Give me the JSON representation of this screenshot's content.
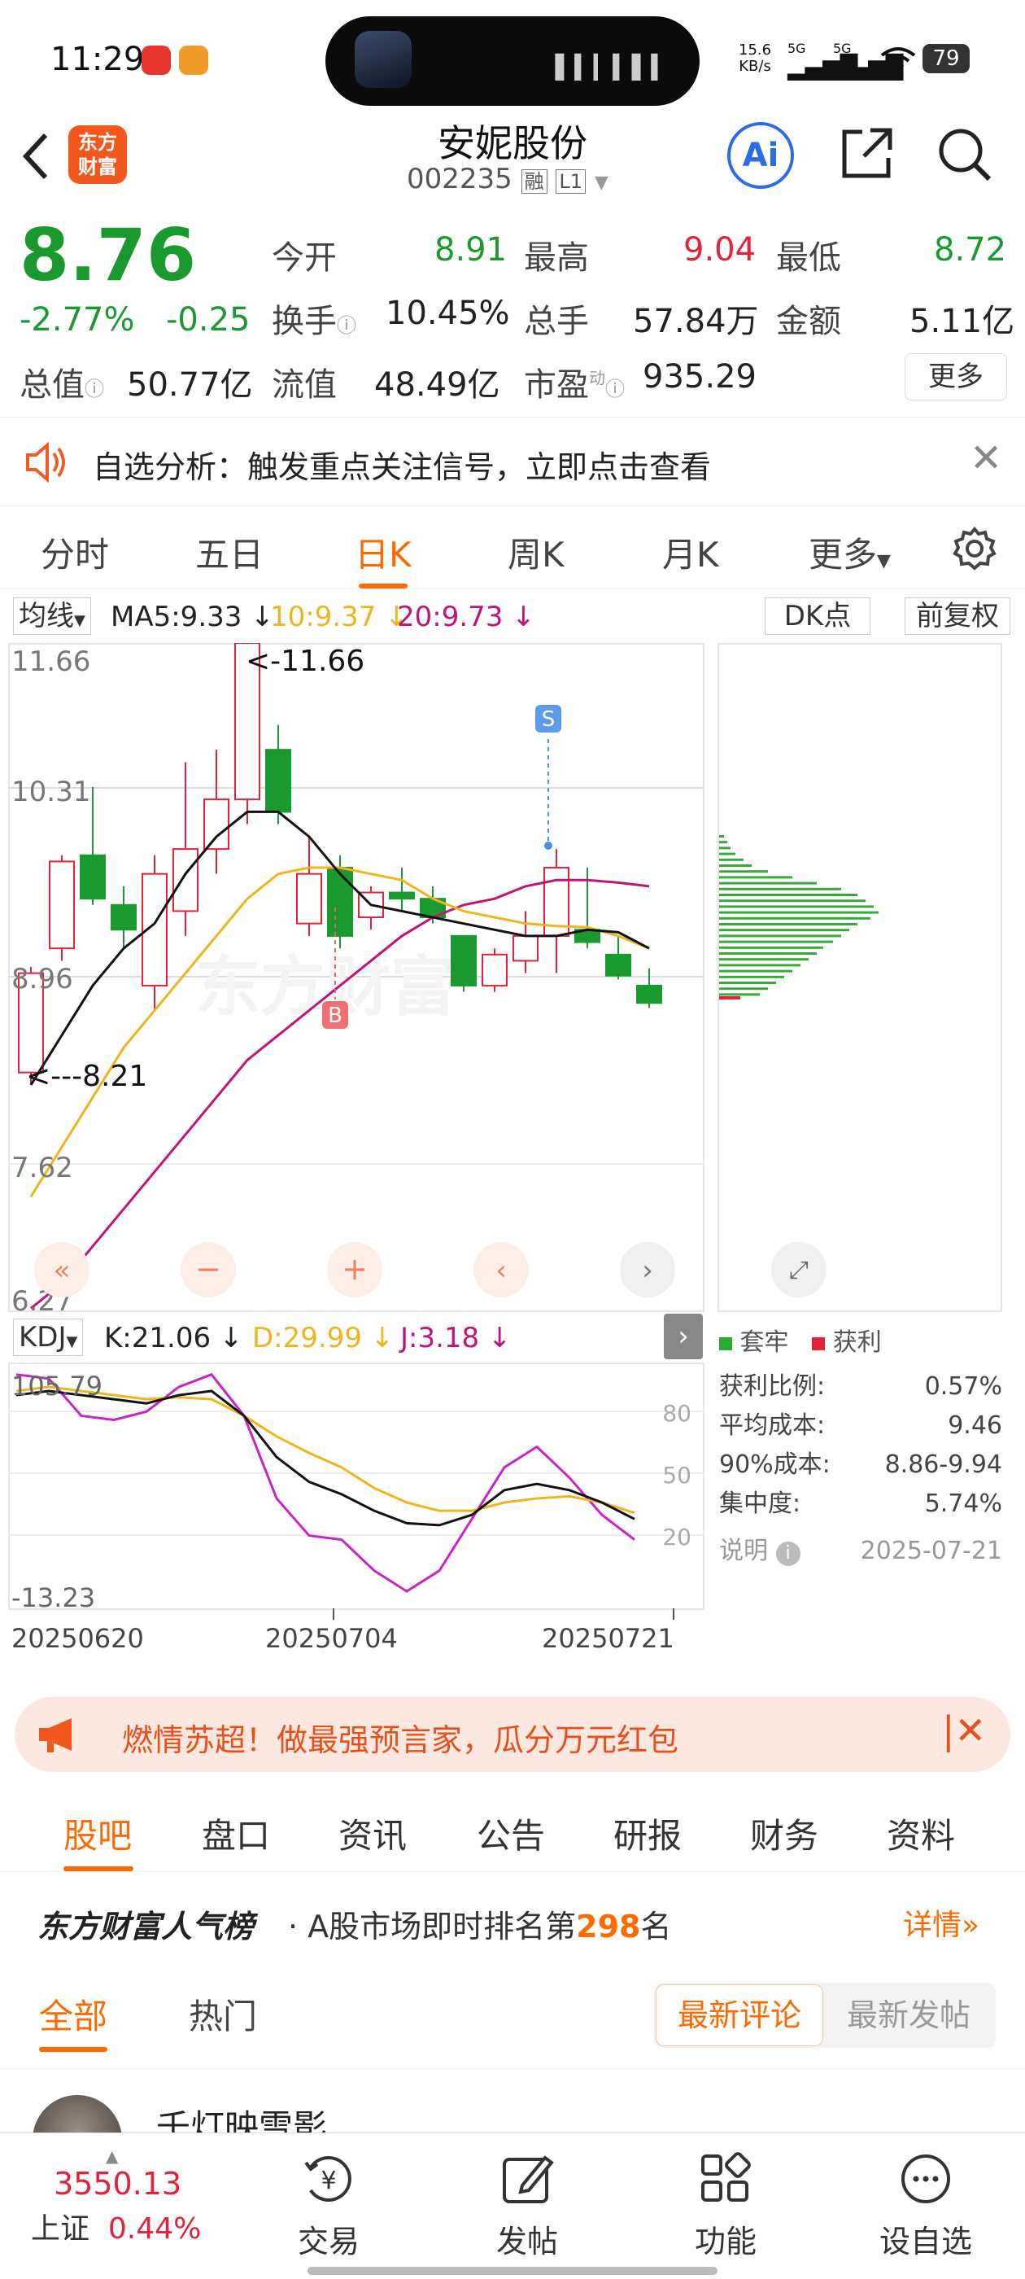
{
  "status": {
    "time": "11:29",
    "net_speed": "15.6",
    "net_unit": "KB/s",
    "sig1": "5G",
    "sig2": "5G",
    "battery": "79"
  },
  "nav": {
    "title": "安妮股份",
    "code": "002235",
    "tag1": "融",
    "tag2": "L1",
    "logo_line1": "东方",
    "logo_line2": "财富",
    "ai": "Ai"
  },
  "quote": {
    "price": "8.76",
    "pct": "-2.77%",
    "chg": "-0.25",
    "open_label": "今开",
    "open": "8.91",
    "high_label": "最高",
    "high": "9.04",
    "low_label": "最低",
    "low": "8.72",
    "turnover_label": "换手",
    "turnover": "10.45%",
    "volume_label": "总手",
    "volume": "57.84万",
    "amount_label": "金额",
    "amount": "5.11亿",
    "mktcap_label": "总值",
    "mktcap": "50.77亿",
    "float_label": "流值",
    "float": "48.49亿",
    "pe_label": "市盈",
    "pe_sup": "动",
    "pe": "935.29",
    "more": "更多"
  },
  "notice": {
    "text": "自选分析：触发重点关注信号，立即点击查看"
  },
  "chart_tabs": [
    "分时",
    "五日",
    "日K",
    "周K",
    "月K",
    "更多"
  ],
  "ma_bar": {
    "sel": "均线",
    "ma5": "MA5:9.33 ↓",
    "ma10": "10:9.37 ↓",
    "ma20": "20:9.73 ↓",
    "dk": "DK点",
    "adj": "前复权"
  },
  "kline_labels": {
    "y1": "11.66",
    "y2": "10.31",
    "y3": "8.96",
    "y4": "7.62",
    "y5": "6.27",
    "hi": "<-11.66",
    "lo": "<---8.21",
    "s": "S",
    "b": "B",
    "watermark": "东方财富"
  },
  "kdj_bar": {
    "sel": "KDJ",
    "k": "K:21.06 ↓",
    "d": "D:29.99 ↓",
    "j": "J:3.18 ↓"
  },
  "kdj_labels": {
    "top": "105.79",
    "bot": "-13.23",
    "l80": "80",
    "l50": "50",
    "l20": "20"
  },
  "dates": {
    "d1": "20250620",
    "d2": "20250704",
    "d3": "20250721"
  },
  "chip": {
    "legend_trap": "套牢",
    "legend_profit": "获利",
    "rows": [
      {
        "k": "获利比例:",
        "v": "0.57%"
      },
      {
        "k": "平均成本:",
        "v": "9.46"
      },
      {
        "k": "90%成本:",
        "v": "8.86-9.94"
      },
      {
        "k": "集中度:",
        "v": "5.74%"
      }
    ],
    "note": "说明",
    "date": "2025-07-21"
  },
  "banner": {
    "text": "燃情苏超！做最强预言家，瓜分万元红包"
  },
  "sub_tabs": [
    "股吧",
    "盘口",
    "资讯",
    "公告",
    "研报",
    "财务",
    "资料"
  ],
  "rank": {
    "brand": "东方财富人气榜",
    "text_a": "· A股市场即时排名第",
    "num": "298",
    "text_b": "名",
    "detail": "详情"
  },
  "filter": {
    "all": "全部",
    "hot": "热门",
    "latest_comment": "最新评论",
    "latest_post": "最新发帖"
  },
  "post": {
    "author": "千灯映雪影"
  },
  "bottom": {
    "index_val": "3550.13",
    "index_name": "上证",
    "index_pct": "0.44%",
    "tabs": [
      "交易",
      "发帖",
      "功能",
      "设自选"
    ]
  },
  "chart_data": {
    "type": "candlestick",
    "dates_visible": [
      "20250620",
      "20250704",
      "20250721"
    ],
    "ylim": [
      6.27,
      11.66
    ],
    "candles": [
      {
        "o": 8.2,
        "c": 9.0,
        "h": 9.05,
        "l": 8.1
      },
      {
        "o": 9.2,
        "c": 9.9,
        "h": 9.95,
        "l": 9.1
      },
      {
        "o": 9.95,
        "c": 9.6,
        "h": 10.5,
        "l": 9.55
      },
      {
        "o": 9.55,
        "c": 9.35,
        "h": 9.7,
        "l": 9.2
      },
      {
        "o": 8.9,
        "c": 9.8,
        "h": 9.95,
        "l": 8.7
      },
      {
        "o": 9.5,
        "c": 10.0,
        "h": 10.7,
        "l": 9.3
      },
      {
        "o": 10.0,
        "c": 10.4,
        "h": 10.8,
        "l": 9.8
      },
      {
        "o": 10.4,
        "c": 11.66,
        "h": 11.66,
        "l": 10.2
      },
      {
        "o": 10.8,
        "c": 10.3,
        "h": 11.0,
        "l": 10.2
      },
      {
        "o": 9.4,
        "c": 9.8,
        "h": 10.1,
        "l": 9.3
      },
      {
        "o": 9.85,
        "c": 9.3,
        "h": 9.95,
        "l": 9.2
      },
      {
        "o": 9.45,
        "c": 9.65,
        "h": 9.7,
        "l": 9.35
      },
      {
        "o": 9.65,
        "c": 9.6,
        "h": 9.85,
        "l": 9.5
      },
      {
        "o": 9.6,
        "c": 9.45,
        "h": 9.7,
        "l": 9.4
      },
      {
        "o": 9.3,
        "c": 8.9,
        "h": 9.3,
        "l": 8.85
      },
      {
        "o": 8.9,
        "c": 9.15,
        "h": 9.2,
        "l": 8.85
      },
      {
        "o": 9.1,
        "c": 9.3,
        "h": 9.5,
        "l": 9.0
      },
      {
        "o": 9.3,
        "c": 9.85,
        "h": 10.0,
        "l": 9.0
      },
      {
        "o": 9.35,
        "c": 9.25,
        "h": 9.85,
        "l": 9.2
      },
      {
        "o": 9.15,
        "c": 8.98,
        "h": 9.3,
        "l": 8.95
      },
      {
        "o": 8.9,
        "c": 8.76,
        "h": 9.04,
        "l": 8.72
      }
    ],
    "ma5": [
      8.1,
      8.5,
      8.9,
      9.2,
      9.4,
      9.8,
      10.1,
      10.3,
      10.3,
      10.1,
      9.8,
      9.55,
      9.5,
      9.45,
      9.4,
      9.35,
      9.3,
      9.3,
      9.35,
      9.33,
      9.2
    ],
    "ma10": [
      7.2,
      7.6,
      8.0,
      8.4,
      8.7,
      9.0,
      9.3,
      9.6,
      9.8,
      9.85,
      9.85,
      9.8,
      9.75,
      9.6,
      9.5,
      9.45,
      9.4,
      9.38,
      9.37,
      9.3,
      9.2
    ],
    "ma20": [
      6.3,
      6.5,
      6.8,
      7.1,
      7.4,
      7.7,
      8.0,
      8.3,
      8.5,
      8.7,
      8.9,
      9.1,
      9.3,
      9.45,
      9.55,
      9.6,
      9.7,
      9.75,
      9.75,
      9.73,
      9.7
    ],
    "kdj_ylim": [
      -13.23,
      105.79
    ],
    "K": [
      90,
      92,
      90,
      88,
      86,
      90,
      92,
      80,
      60,
      48,
      42,
      34,
      28,
      27,
      32,
      44,
      47,
      44,
      38,
      30
    ],
    "D": [
      92,
      94,
      92,
      90,
      88,
      89,
      88,
      80,
      70,
      62,
      55,
      45,
      38,
      34,
      34,
      38,
      40,
      41,
      38,
      33
    ],
    "J": [
      100,
      98,
      80,
      78,
      82,
      94,
      100,
      80,
      40,
      22,
      20,
      5,
      -5,
      5,
      30,
      55,
      65,
      50,
      32,
      20
    ]
  }
}
